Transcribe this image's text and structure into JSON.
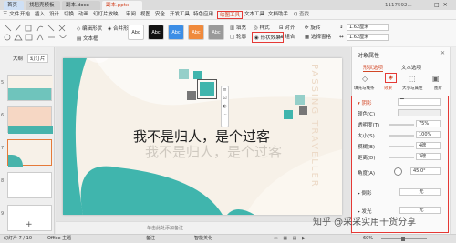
{
  "tabs": [
    {
      "label": "首页"
    },
    {
      "label": "找稻壳模板"
    },
    {
      "label": "副本.docx"
    },
    {
      "label": "副本.pptx",
      "active": true
    },
    {
      "label": "+"
    }
  ],
  "user": {
    "name": "1117592..."
  },
  "menu": [
    "三 文件",
    "开始",
    "插入",
    "设计",
    "切换",
    "动画",
    "幻灯片放映",
    "审阅",
    "视图",
    "安全",
    "开发工具",
    "特色应用",
    "绘图工具",
    "文本工具",
    "文档助手"
  ],
  "menu_search": "Q 查找",
  "ribbon": {
    "shapes_label": "编辑形状",
    "textbox_label": "文本框",
    "merge_label": "合并形状",
    "swatch_text": "Abc",
    "swatches": [
      {
        "bg": "#ffffff",
        "fg": "#333333"
      },
      {
        "bg": "#111111",
        "fg": "#ffffff"
      },
      {
        "bg": "#3c8ee6",
        "fg": "#ffffff"
      },
      {
        "bg": "#f08a3c",
        "fg": "#ffffff"
      },
      {
        "bg": "#9a9a9a",
        "fg": "#ffffff"
      }
    ],
    "fill_label": "填充",
    "outline_label": "轮廓",
    "format_label": "形状效果",
    "style_label": "样式",
    "align_label": "对齐",
    "group_label": "组合",
    "rotate_label": "旋转",
    "select_label": "选择窗格",
    "width_value": "1.62厘米",
    "height_value": "1.62厘米"
  },
  "left": {
    "outline_tab": "大纲",
    "slides_tab": "幻灯片",
    "thumbs": [
      "",
      "",
      "",
      "",
      ""
    ],
    "add_label": "+"
  },
  "slide": {
    "main_text": "我不是归人，是个过客",
    "shadow_text": "我不是归人，是个过客",
    "vertical_text": "PASSING TRAVELLER"
  },
  "notes_placeholder": "单击此处添加备注",
  "panel": {
    "title": "对象属性",
    "tab_shape": "形状选项",
    "tab_text": "文本选项",
    "sub_tabs": [
      "填充与线条",
      "效果",
      "大小与属性",
      "图片"
    ],
    "section_shadow": "阴影",
    "rows": [
      {
        "label": "颜色(C)",
        "value": ""
      },
      {
        "label": "透明度(T)",
        "value": "75%"
      },
      {
        "label": "大小(S)",
        "value": "100%"
      },
      {
        "label": "模糊(B)",
        "value": "4磅"
      },
      {
        "label": "距离(D)",
        "value": "3磅"
      },
      {
        "label": "角度(A)",
        "value": "45.0°"
      }
    ],
    "reflection_label": "倒影",
    "reflection_value": "无",
    "glow_label": "发光",
    "glow_value": "无"
  },
  "status": {
    "slide_info": "幻灯片 7 / 10",
    "theme": "Office 主题",
    "notes_btn": "备注",
    "beautify": "智能美化",
    "zoom": "60%"
  },
  "watermark": "知乎 @采采实用干货分享",
  "colors": {
    "teal": "#40b5ad",
    "accent_red": "#e53935",
    "slide_bg": "#f7f1e8"
  }
}
